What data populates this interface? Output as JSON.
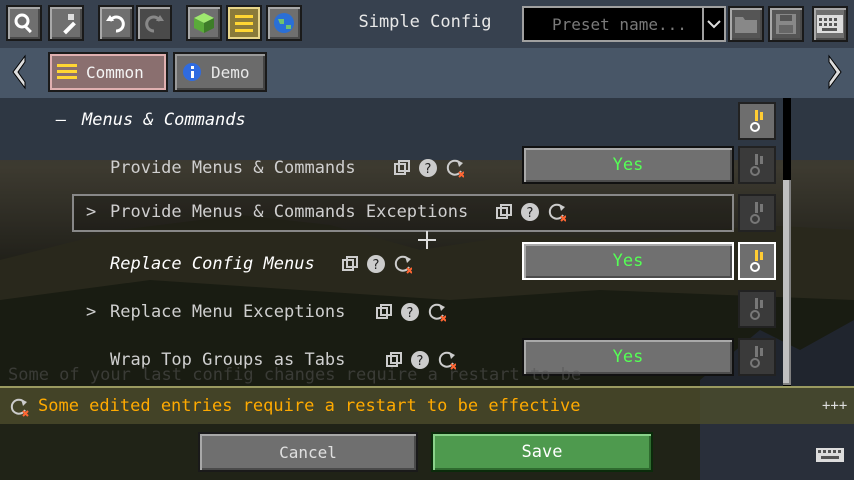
{
  "window": {
    "title": "Simple Config"
  },
  "toolbar": {
    "preset_placeholder": "Preset name...",
    "icons": [
      "search-icon",
      "edit-wand-icon",
      "undo-icon",
      "redo-icon",
      "cube-icon",
      "list-icon",
      "globe-icon",
      "folder-icon",
      "save-disk-icon",
      "keyboard-icon"
    ]
  },
  "tabs": [
    {
      "label": "Common",
      "selected": true
    },
    {
      "label": "Demo",
      "selected": false
    }
  ],
  "list": {
    "section_title": "Menus & Commands",
    "section_toggle": "–",
    "rows": [
      {
        "label": "Provide Menus & Commands",
        "value": "Yes",
        "expander": ""
      },
      {
        "label": "Provide Menus & Commands Exceptions",
        "value": "",
        "expander": ">"
      },
      {
        "label": "Replace Config Menus",
        "value": "Yes",
        "expander": ""
      },
      {
        "label": "Replace Menu Exceptions",
        "value": "",
        "expander": ">"
      },
      {
        "label": "Wrap Top Groups as Tabs",
        "value": "Yes",
        "expander": ""
      }
    ]
  },
  "status": {
    "message": "Some edited entries require a restart to be effective",
    "ghost_message": "Some of your last config changes require a restart to be",
    "more": "+++"
  },
  "buttons": {
    "cancel": "Cancel",
    "save": "Save"
  },
  "colors": {
    "value_yes": "#55ff55",
    "status_text": "#ffaa00",
    "save_bg": "#4e9a4e"
  }
}
